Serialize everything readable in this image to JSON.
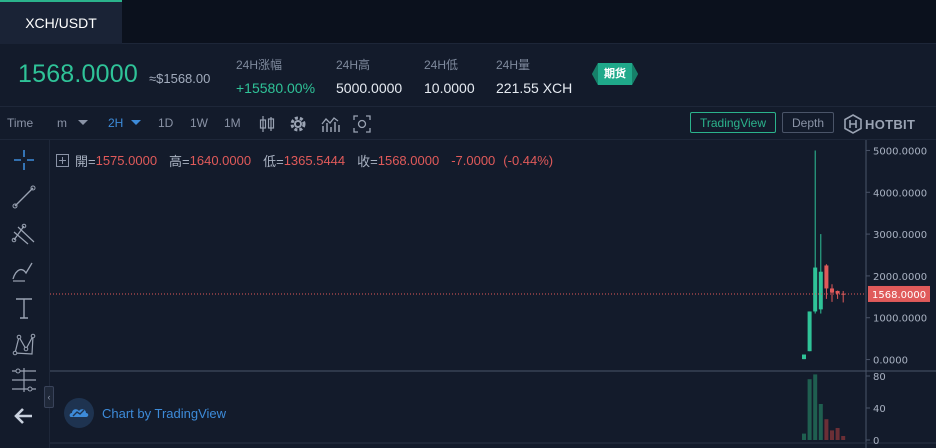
{
  "tab": {
    "pair": "XCH/USDT"
  },
  "ticker": {
    "last_price": "1568.0000",
    "usd_price": "≈$1568.00",
    "stats": [
      {
        "label": "24H涨幅",
        "value": "+15580.00%"
      },
      {
        "label": "24H高",
        "value": "5000.0000"
      },
      {
        "label": "24H低",
        "value": "10.0000"
      },
      {
        "label": "24H量",
        "value": "221.55 XCH"
      }
    ],
    "badge": "期货",
    "colors": {
      "up": "#2fc398",
      "down": "#e05a5a",
      "accent": "#3d8bd9"
    }
  },
  "toolbar": {
    "time_label": "Time",
    "interval_m": "m",
    "interval_active": "2H",
    "intervals": [
      "1D",
      "1W",
      "1M"
    ],
    "tradingview_btn": "TradingView",
    "depth_btn": "Depth",
    "brand": "HOTBIT",
    "icons": [
      "candles-icon",
      "settings-gear-icon",
      "indicators-icon",
      "screenshot-icon"
    ]
  },
  "ohlc": {
    "open_label": "開=",
    "open": "1575.0000",
    "high_label": "高=",
    "high": "1640.0000",
    "low_label": "低=",
    "low": "1365.5444",
    "close_label": "收=",
    "close": "1568.0000",
    "change": "-7.0000",
    "change_pct": "(-0.44%)"
  },
  "sidebar": {
    "icons": [
      "crosshair-icon",
      "trend-line-icon",
      "pitchfork-icon",
      "brush-icon",
      "text-icon",
      "pattern-icon",
      "measure-icon",
      "back-arrow-icon"
    ]
  },
  "watermark": "Chart by TradingView",
  "chart_data": {
    "type": "candlestick",
    "price_axis": {
      "ticks": [
        "5000.0000",
        "4000.0000",
        "3000.0000",
        "2000.0000",
        "1000.0000",
        "0.0000"
      ],
      "range": [
        -250,
        5250
      ],
      "current_price_label": "1568.0000",
      "current_price": 1568
    },
    "volume_axis": {
      "ticks": [
        "80",
        "40",
        "0"
      ],
      "range": [
        0,
        85
      ]
    },
    "candles": [
      {
        "o": 10,
        "h": 120,
        "l": 10,
        "c": 120,
        "v": 8
      },
      {
        "o": 200,
        "h": 1150,
        "l": 200,
        "c": 1150,
        "v": 76
      },
      {
        "o": 1150,
        "h": 5000,
        "l": 1100,
        "c": 2200,
        "v": 82
      },
      {
        "o": 1200,
        "h": 3000,
        "l": 1100,
        "c": 2100,
        "v": 45
      },
      {
        "o": 2250,
        "h": 2280,
        "l": 1450,
        "c": 1700,
        "v": 26
      },
      {
        "o": 1700,
        "h": 1800,
        "l": 1380,
        "c": 1600,
        "v": 12
      },
      {
        "o": 1640,
        "h": 1650,
        "l": 1450,
        "c": 1580,
        "v": 15
      },
      {
        "o": 1575,
        "h": 1640,
        "l": 1365.5444,
        "c": 1568,
        "v": 5
      }
    ]
  }
}
